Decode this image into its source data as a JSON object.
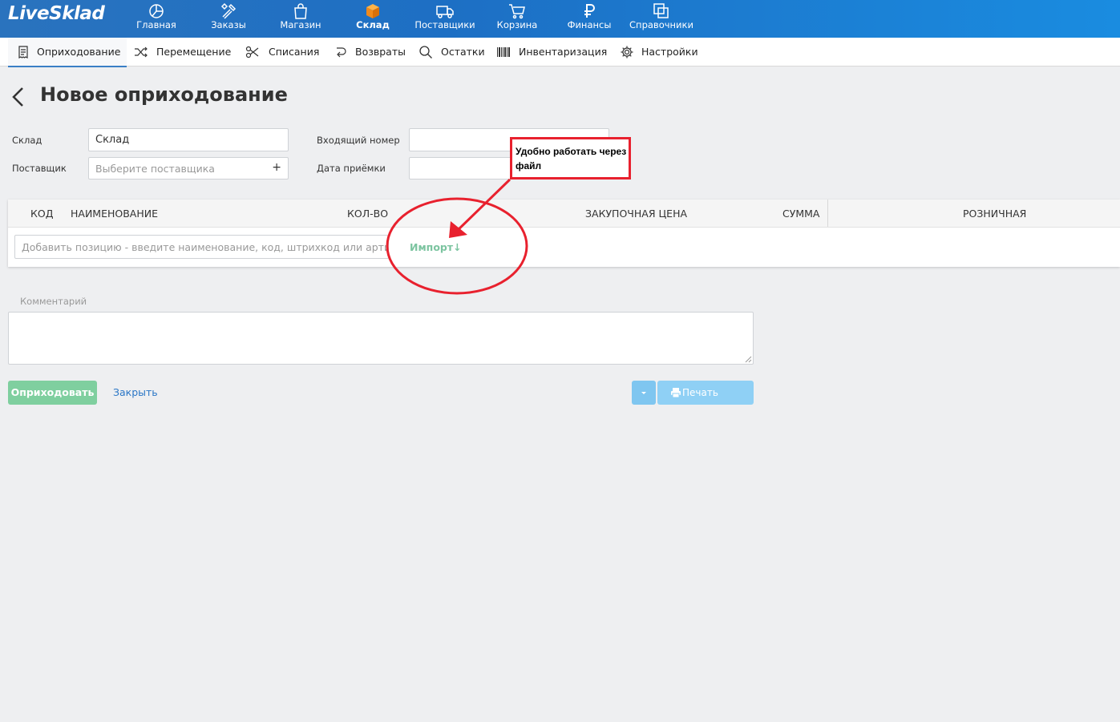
{
  "app": {
    "logo": "LiveSklad"
  },
  "topnav": {
    "items": [
      {
        "label": "Главная",
        "icon": "pie-chart-icon"
      },
      {
        "label": "Заказы",
        "icon": "tools-icon"
      },
      {
        "label": "Магазин",
        "icon": "shopping-bag-icon"
      },
      {
        "label": "Склад",
        "icon": "warehouse-box-icon",
        "active": true
      },
      {
        "label": "Поставщики",
        "icon": "truck-icon"
      },
      {
        "label": "Корзина",
        "icon": "cart-icon"
      },
      {
        "label": "Финансы",
        "icon": "ruble-icon"
      },
      {
        "label": "Справочники",
        "icon": "copy-icon"
      }
    ]
  },
  "subnav": {
    "items": [
      {
        "label": "Оприходование",
        "icon": "receipt-icon",
        "active": true
      },
      {
        "label": "Перемещение",
        "icon": "shuffle-icon"
      },
      {
        "label": "Списания",
        "icon": "scissors-icon"
      },
      {
        "label": "Возвраты",
        "icon": "return-icon"
      },
      {
        "label": "Остатки",
        "icon": "search-icon"
      },
      {
        "label": "Инвентаризация",
        "icon": "barcode-icon"
      },
      {
        "label": "Настройки",
        "icon": "gear-icon"
      }
    ]
  },
  "page": {
    "title": "Новое оприходование"
  },
  "form": {
    "warehouse_label": "Склад",
    "warehouse_value": "Склад",
    "supplier_label": "Поставщик",
    "supplier_placeholder": "Выберите поставщика",
    "incoming_number_label": "Входящий номер",
    "incoming_number_value": "",
    "receipt_date_label": "Дата приёмки",
    "receipt_date_value": ""
  },
  "table": {
    "columns": [
      "КОД",
      "НАИМЕНОВАНИЕ",
      "КОЛ-ВО",
      "ЗАКУПОЧНАЯ ЦЕНА",
      "СУММА",
      "РОЗНИЧНАЯ"
    ],
    "add_placeholder": "Добавить позицию - введите наименование, код, штрихкод или артикул",
    "import_label": "Импорт↓"
  },
  "comment": {
    "label": "Комментарий",
    "value": ""
  },
  "actions": {
    "submit_label": "Оприходовать",
    "close_label": "Закрыть",
    "print_label": "Печать"
  },
  "annotation": {
    "text": "Удобно работать через файл",
    "color": "#e8212e"
  },
  "colors": {
    "topbar": "#1d6fc4",
    "accent_green": "#7fcf9f",
    "accent_blue": "#8fd0f5",
    "link": "#2a76c6"
  }
}
